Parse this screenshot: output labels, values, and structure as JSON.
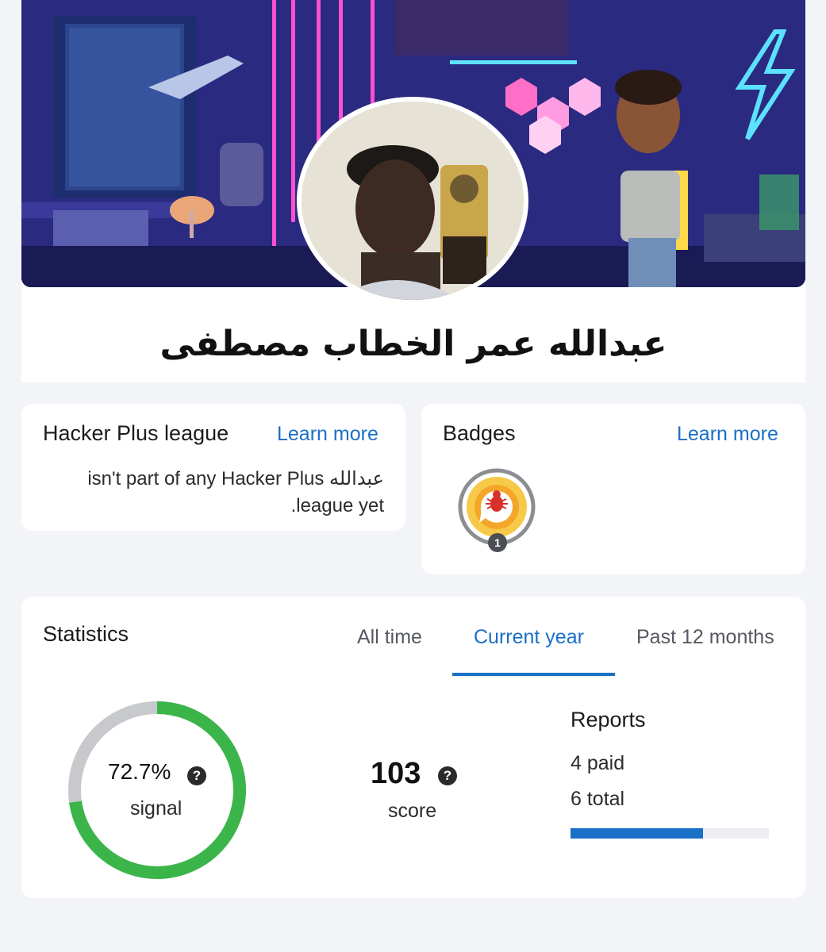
{
  "profile": {
    "name": "عبدالله عمر الخطاب مصطفى"
  },
  "league": {
    "title": "Hacker Plus league",
    "learn_more": "Learn more",
    "description": "عبدالله isn't part of any Hacker Plus league yet."
  },
  "badges": {
    "title": "Badges",
    "learn_more": "Learn more",
    "items": [
      {
        "icon": "bug-badge-icon",
        "count": "1"
      }
    ]
  },
  "statistics": {
    "title": "Statistics",
    "tabs": [
      "All time",
      "Current year",
      "Past 12 months"
    ],
    "active_tab": "Current year",
    "signal": {
      "value": "72.7%",
      "label": "signal",
      "fraction": 0.727
    },
    "score": {
      "value": "103",
      "label": "score"
    },
    "reports": {
      "title": "Reports",
      "paid": "4 paid",
      "total": "6 total",
      "paid_fraction": 0.667
    }
  },
  "colors": {
    "accent": "#1a6fc7",
    "signal_green": "#3bb54a",
    "ring_gray": "#c7c9cc"
  }
}
